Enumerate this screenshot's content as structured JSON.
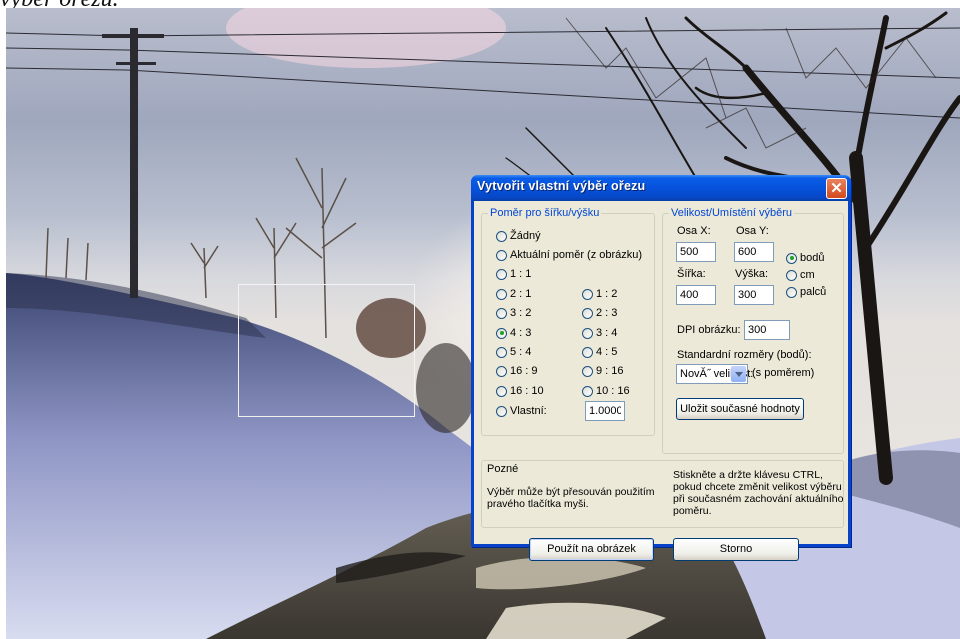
{
  "caption": "výběr ořezu.",
  "dialog": {
    "title": "Vytvořit vlastní výběr ořezu",
    "ratio_group": {
      "legend": "Poměr pro šířku/výšku",
      "options": [
        {
          "label": "Žádný",
          "selected": false
        },
        {
          "label": "Aktuální poměr (z obrázku)",
          "selected": false
        },
        {
          "label": "1 : 1",
          "selected": false
        },
        {
          "label": "2 : 1",
          "selected": false
        },
        {
          "label": "1 : 2",
          "selected": false
        },
        {
          "label": "3 : 2",
          "selected": false
        },
        {
          "label": "2 : 3",
          "selected": false
        },
        {
          "label": "4 : 3",
          "selected": true
        },
        {
          "label": "3 : 4",
          "selected": false
        },
        {
          "label": "5 : 4",
          "selected": false
        },
        {
          "label": "4 : 5",
          "selected": false
        },
        {
          "label": "16 : 9",
          "selected": false
        },
        {
          "label": "9 : 16",
          "selected": false
        },
        {
          "label": "16 : 10",
          "selected": false
        },
        {
          "label": "10 : 16",
          "selected": false
        },
        {
          "label": "Vlastní:",
          "selected": false
        }
      ],
      "custom_value": "1.0000"
    },
    "size_group": {
      "legend": "Velikost/Umístění výběru",
      "osa_x_label": "Osa X:",
      "osa_x_value": "500",
      "osa_y_label": "Osa Y:",
      "osa_y_value": "600",
      "sirka_label": "Šířka:",
      "sirka_value": "400",
      "vyska_label": "Výška:",
      "vyska_value": "300",
      "units": [
        {
          "label": "bodů",
          "selected": true
        },
        {
          "label": "cm",
          "selected": false
        },
        {
          "label": "palců",
          "selected": false
        }
      ],
      "dpi_label": "DPI obrázku:",
      "dpi_value": "300",
      "standard_label": "Standardní rozměry (bodů):",
      "standard_selected": "NovĂ˝ velikost:",
      "standard_suffix": "(s poměrem)",
      "save_button": "Uložit současné hodnoty"
    },
    "notes": {
      "heading": "Pozné",
      "left": "Výběr může být přesouván použitím pravého tlačítka myši.",
      "right": "Stiskněte a držte klávesu CTRL, pokud chcete změnit velikost výběru při současném zachování aktuálního poměru."
    },
    "apply_button": "Použít na obrázek",
    "cancel_button": "Storno"
  }
}
